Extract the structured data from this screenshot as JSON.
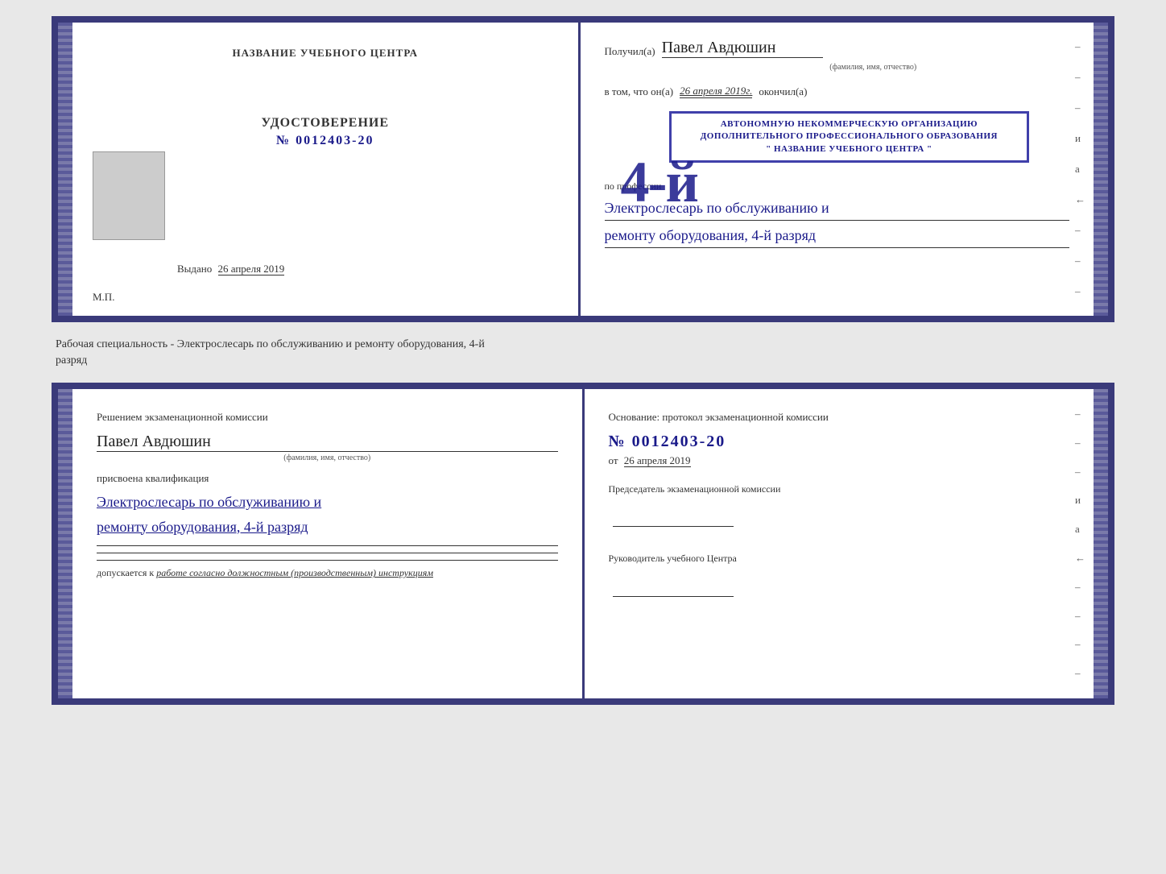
{
  "topCert": {
    "leftPage": {
      "title": "НАЗВАНИЕ УЧЕБНОГО ЦЕНТРА",
      "docTitle": "УДОСТОВЕРЕНИЕ",
      "docNumber": "№ 0012403-20",
      "issuedLabel": "Выдано",
      "issuedDate": "26 апреля 2019",
      "mp": "М.П."
    },
    "rightPage": {
      "receivedLabel": "Получил(а)",
      "receivedName": "Павел Авдюшин",
      "fioSubtext": "(фамилия, имя, отчество)",
      "vtomLabel": "в том, что он(а)",
      "vtomDate": "26 апреля 2019г.",
      "finishedLabel": "окончил(а)",
      "stampLine1": "АВТОНОМНУЮ НЕКОММЕРЧЕСКУЮ ОРГАНИЗАЦИЮ",
      "stampLine2": "ДОПОЛНИТЕЛЬНОГО ПРОФЕССИОНАЛЬНОГО ОБРАЗОВАНИЯ",
      "stampLine3": "\" НАЗВАНИЕ УЧЕБНОГО ЦЕНТРА \"",
      "professionLabel": "по профессии",
      "professionLine1": "Электрослесарь по обслуживанию и",
      "professionLine2": "ремонту оборудования, 4-й разряд",
      "bigNumber": "4-й",
      "dashes": [
        "-",
        "-",
        "-",
        "и",
        "а",
        "←",
        "-",
        "-",
        "-"
      ]
    }
  },
  "separator": {
    "line1": "Рабочая специальность - Электрослесарь по обслуживанию и ремонту оборудования, 4-й",
    "line2": "разряд"
  },
  "bottomCert": {
    "leftPage": {
      "decisionText": "Решением экзаменационной  комиссии",
      "personName": "Павел Авдюшин",
      "fioSubtext": "(фамилия, имя, отчество)",
      "assignedLabel": "присвоена квалификация",
      "qual1": "Электрослесарь по обслуживанию и",
      "qual2": "ремонту оборудования, 4-й разряд",
      "allowText": "допускается к",
      "allowItalic": "работе согласно должностным (производственным) инструкциям"
    },
    "rightPage": {
      "basisLabel": "Основание: протокол экзаменационной  комиссии",
      "numberLabel": "№ 0012403-20",
      "fromLabel": "от",
      "fromDate": "26 апреля 2019",
      "chairLabel": "Председатель экзаменационной комиссии",
      "headLabel": "Руководитель учебного Центра",
      "dashes": [
        "-",
        "-",
        "-",
        "и",
        "а",
        "←",
        "-",
        "-",
        "-",
        "-"
      ]
    }
  }
}
